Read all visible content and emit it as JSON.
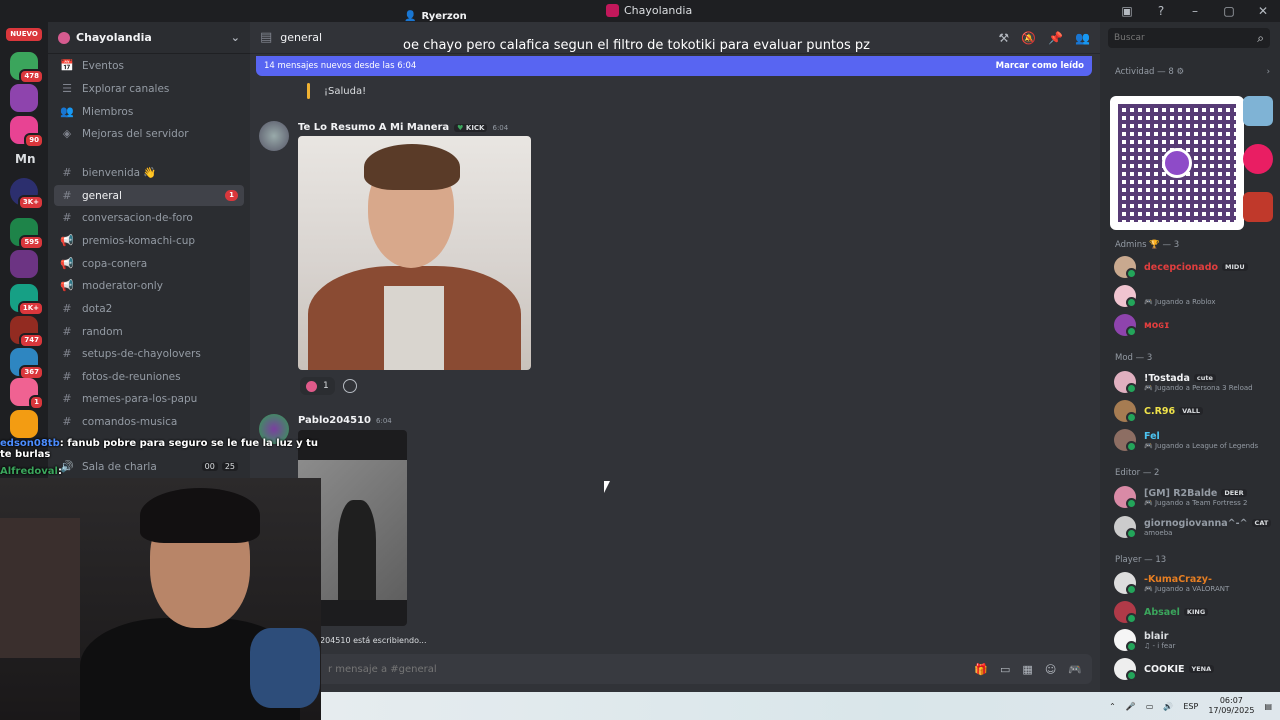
{
  "window": {
    "title": "Chayolandia",
    "user": "Ryerzon",
    "controls": [
      "–",
      "▢",
      "✕"
    ]
  },
  "rail": {
    "nuevo": "NUEVO",
    "mn": "Mn",
    "badges": [
      "478",
      "90",
      "3K+",
      "595",
      "1K+",
      "747",
      "367",
      "1"
    ]
  },
  "server": {
    "name": "Chayolandia",
    "chevron": "⌄"
  },
  "sidebar": {
    "items": [
      {
        "label": "Eventos",
        "icon": "📅"
      },
      {
        "label": "Explorar canales",
        "icon": "☰"
      },
      {
        "label": "Miembros",
        "icon": "👥"
      },
      {
        "label": "Mejoras del servidor",
        "icon": "◈"
      },
      {
        "label": "bienvenida 👋",
        "icon": "#"
      },
      {
        "label": "general",
        "icon": "#",
        "unread": "1"
      },
      {
        "label": "conversacion-de-foro",
        "icon": "#"
      },
      {
        "label": "premios-komachi-cup",
        "icon": "📢"
      },
      {
        "label": "copa-conera",
        "icon": "📢"
      },
      {
        "label": "moderator-only",
        "icon": "📢"
      },
      {
        "label": "dota2",
        "icon": "#"
      },
      {
        "label": "random",
        "icon": "#"
      },
      {
        "label": "setups-de-chayolovers",
        "icon": "#"
      },
      {
        "label": "fotos-de-reuniones",
        "icon": "#"
      },
      {
        "label": "memes-para-los-papu",
        "icon": "#"
      },
      {
        "label": "comandos-musica",
        "icon": "#"
      }
    ],
    "voice": {
      "label": "Sala de charla",
      "count_a": "00",
      "count_b": "25"
    }
  },
  "chat": {
    "channel": "general",
    "new_messages": "14 mensajes nuevos desde las 6:04",
    "mark_read": "Marcar como leído",
    "quote": "¡Saluda!",
    "messages": [
      {
        "author": "Te Lo Resumo A Mi Manera",
        "tag": "KICK",
        "time": "6:04",
        "reaction_count": "1"
      },
      {
        "author": "Pablo204510",
        "time": "6:04"
      }
    ],
    "typing": "204510 está escribiendo...",
    "input_placeholder": "r mensaje a #general"
  },
  "caption": "oe chayo pero calafica segun el filtro de tokotiki para evaluar puntos pz",
  "right": {
    "search_placeholder": "Buscar",
    "activity": "Actividad — 8 ⚙",
    "groups": [
      {
        "title": "Admins 🏆 — 3",
        "members": [
          {
            "name": "decepcionado",
            "tag": "MIDU",
            "sub": "",
            "color": "#e03e3e"
          },
          {
            "name": "⠀",
            "tag": "",
            "sub": "🎮 Jugando a Roblox",
            "color": "#e03e3e"
          },
          {
            "name": "ᴍᴏɢɪ",
            "tag": "",
            "sub": "",
            "color": "#e03e3e"
          }
        ]
      },
      {
        "title": "Mod — 3",
        "members": [
          {
            "name": "!Tostada",
            "tag": "cute",
            "sub": "🎮 Jugando a Persona 3 Reload",
            "color": "#f2f3f5"
          },
          {
            "name": "C.R96",
            "tag": "VALL",
            "sub": "",
            "color": "#f0e34a"
          },
          {
            "name": "Fel",
            "tag": "",
            "sub": "🎮 Jugando a League of Legends",
            "color": "#4cc3f0"
          }
        ]
      },
      {
        "title": "Editor — 2",
        "members": [
          {
            "name": "[GM] R2Balde",
            "tag": "DEER",
            "sub": "🎮 Jugando a Team Fortress 2",
            "color": "#949ba4"
          },
          {
            "name": "giornogiovanna^-^",
            "tag": "CAT",
            "sub": "amoeba",
            "color": "#949ba4"
          }
        ]
      },
      {
        "title": "Player — 13",
        "members": [
          {
            "name": "-KumaCrazy-",
            "tag": "",
            "sub": "🎮 Jugando a VALORANT",
            "color": "#e67e22"
          },
          {
            "name": "Absael",
            "tag": "KING",
            "sub": "",
            "color": "#3ba55c"
          },
          {
            "name": "blair",
            "tag": "",
            "sub": "♫ - i fear",
            "color": "#dbdee1"
          },
          {
            "name": "COOKIE",
            "tag": "YENA",
            "sub": "",
            "color": "#f2f3f5"
          }
        ]
      }
    ]
  },
  "overlay": {
    "line1_user": "edson08tb",
    "line1_text": ": fanub pobre para seguro se le fue la luz y tu te burlas",
    "line2_user": "Alfredoval",
    "line2_text": ":"
  },
  "taskbar": {
    "lang": "ESP",
    "time": "06:07",
    "date": "17/09/2025"
  }
}
